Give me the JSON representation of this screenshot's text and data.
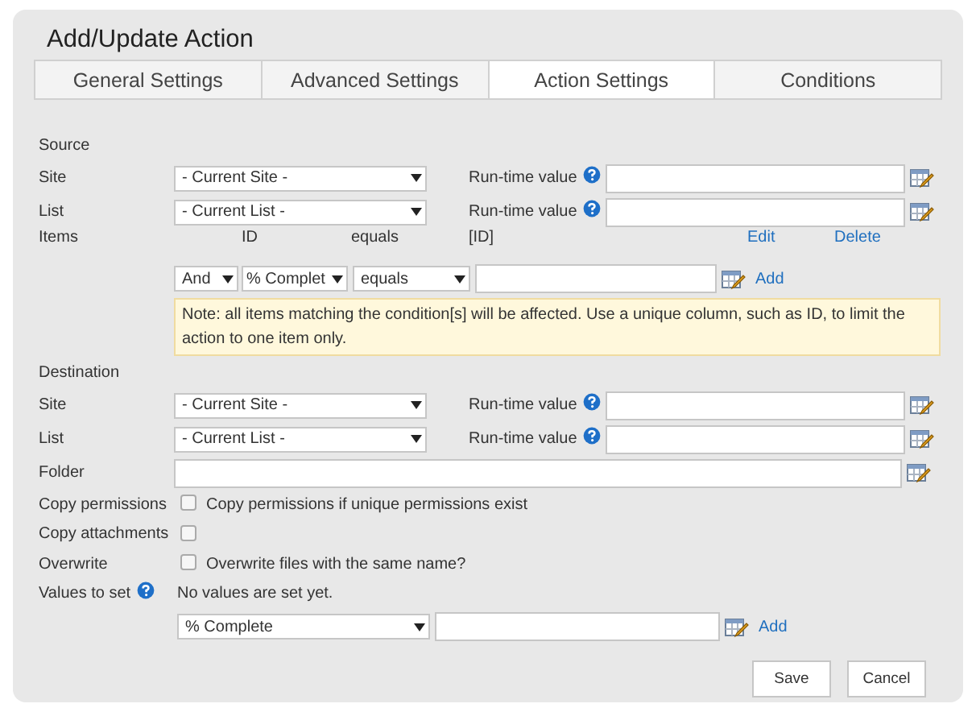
{
  "title": "Add/Update Action",
  "tabs": [
    {
      "label": "General Settings",
      "selected": false
    },
    {
      "label": "Advanced Settings",
      "selected": false
    },
    {
      "label": "Action Settings",
      "selected": true
    },
    {
      "label": "Conditions",
      "selected": false
    }
  ],
  "source": {
    "heading": "Source",
    "rows": [
      {
        "label": "Site",
        "value": "- Current Site -",
        "runtime_label": "Run-time value"
      },
      {
        "label": "List",
        "value": "- Current List -",
        "runtime_label": "Run-time value"
      }
    ]
  },
  "items": {
    "label": "Items",
    "headers": [
      "ID",
      "equals",
      "[ID]"
    ],
    "links": [
      "Edit",
      "Delete"
    ],
    "condition": {
      "join": "And",
      "field": "% Complet",
      "operator": "equals"
    },
    "add": "Add",
    "note": "Note: all items matching the condition[s] will be affected. Use a unique column, such as ID, to limit the action to one item only."
  },
  "destination": {
    "heading": "Destination",
    "rows": [
      {
        "label": "Site",
        "value": "- Current Site -",
        "runtime_label": "Run-time value"
      },
      {
        "label": "List",
        "value": "- Current List -",
        "runtime_label": "Run-time value"
      }
    ]
  },
  "folder": {
    "label": "Folder"
  },
  "options": [
    {
      "label": "Copy permissions",
      "checked": false,
      "text": "Copy permissions if unique permissions exist"
    },
    {
      "label": "Copy attachments",
      "checked": false
    },
    {
      "label": "Overwrite",
      "checked": false,
      "text": "Overwrite files with the same name?"
    }
  ],
  "values": {
    "label": "Values to set",
    "empty_text": "No values are set yet.",
    "field": "% Complete",
    "add": "Add"
  },
  "buttons": [
    "Save",
    "Cancel"
  ]
}
